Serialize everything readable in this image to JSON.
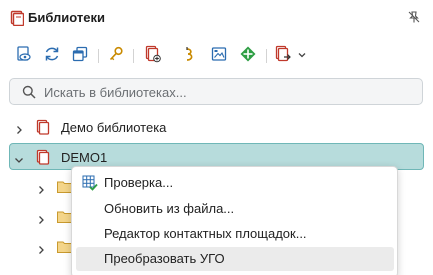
{
  "panel": {
    "title": "Библиотеки",
    "title_icon": "library-book-icon",
    "pin_icon": "pin-off-icon"
  },
  "toolbar": {
    "buttons": [
      {
        "name": "library-view-button",
        "icon": "book-eye-icon"
      },
      {
        "name": "refresh-button",
        "icon": "refresh-icon"
      },
      {
        "name": "copy-button",
        "icon": "copy-windows-icon"
      },
      {
        "name": "key-button",
        "icon": "key-icon"
      },
      {
        "name": "new-library-button",
        "icon": "book-add-icon"
      },
      {
        "name": "symbol-button",
        "icon": "gost-symbol-icon"
      },
      {
        "name": "footprint-button",
        "icon": "footprint-image-icon"
      },
      {
        "name": "component-button",
        "icon": "green-component-icon"
      },
      {
        "name": "export-button",
        "icon": "book-export-icon"
      },
      {
        "name": "more-dropdown-button",
        "icon": "chevron-down-icon"
      }
    ]
  },
  "search": {
    "placeholder": "Искать в библиотеках..."
  },
  "tree": {
    "items": [
      {
        "label": "Демо библиотека",
        "expanded": false
      },
      {
        "label": "DEMO1",
        "expanded": true,
        "selected": true
      }
    ],
    "child_folders_visible": 3
  },
  "context_menu": {
    "items": [
      {
        "label": "Проверка...",
        "icon": "grid-check-icon"
      },
      {
        "label": "Обновить из файла...",
        "icon": ""
      },
      {
        "label": "Редактор контактных площадок...",
        "icon": ""
      },
      {
        "label": "Преобразовать УГО",
        "icon": "",
        "hovered": true
      }
    ]
  },
  "colors": {
    "accent_red": "#c0392b",
    "selection_bg": "#b7dcdc",
    "selection_border": "#6fb7b7",
    "folder": "#e8b84a",
    "icon_blue": "#2b6cb0",
    "icon_green": "#2e9e44"
  }
}
